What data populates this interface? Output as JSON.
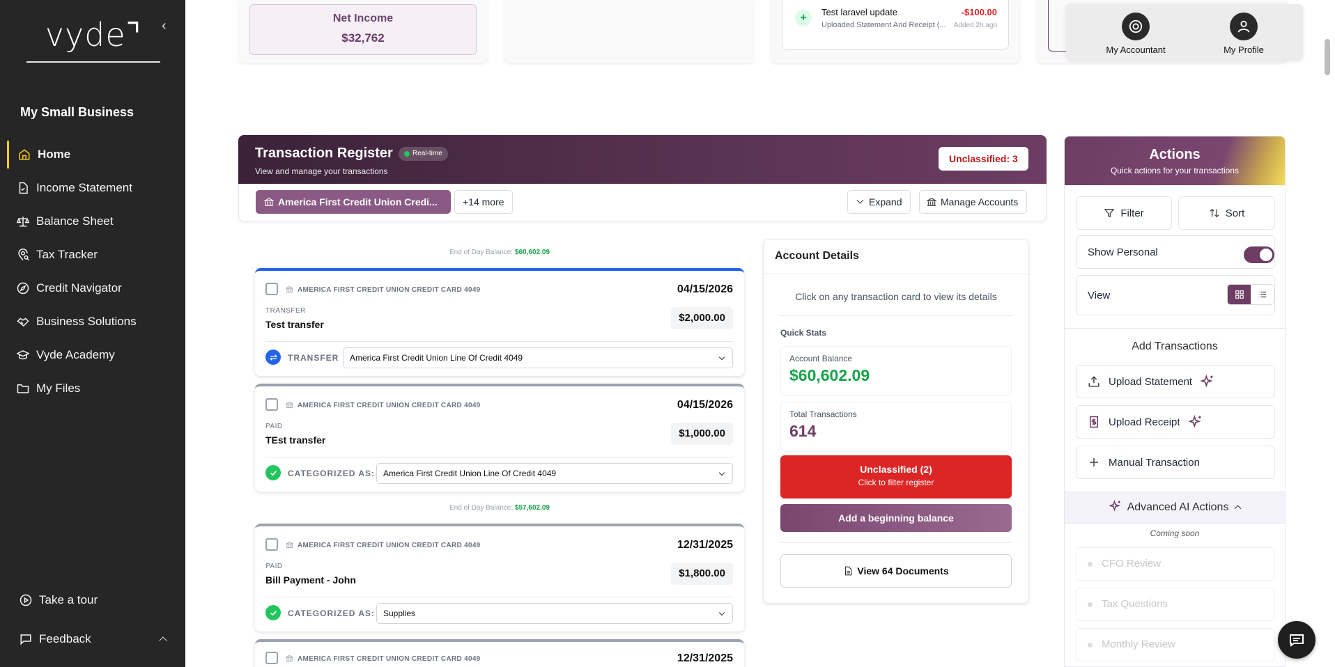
{
  "brand": {
    "logo": "vyde⌝",
    "business_name": "My Small Business"
  },
  "sidebar": {
    "items": [
      {
        "label": "Home",
        "icon": "home-icon",
        "active": true
      },
      {
        "label": "Income Statement",
        "icon": "document-icon"
      },
      {
        "label": "Balance Sheet",
        "icon": "scale-icon"
      },
      {
        "label": "Tax Tracker",
        "icon": "location-search-icon"
      },
      {
        "label": "Credit Navigator",
        "icon": "compass-icon"
      },
      {
        "label": "Business Solutions",
        "icon": "handshake-icon"
      },
      {
        "label": "Vyde Academy",
        "icon": "graduation-cap-icon"
      },
      {
        "label": "My Files",
        "icon": "folder-icon"
      }
    ],
    "tour_label": "Take a tour",
    "feedback_label": "Feedback"
  },
  "summary": {
    "net_income_label": "Net Income",
    "net_income_value": "$32,762"
  },
  "recent_activity": {
    "title": "Test laravel update",
    "subtitle": "Uploaded Statement And Receipt (...",
    "amount": "-$100.00",
    "time": "Added 2h ago"
  },
  "topnav": {
    "accountant_label": "My Accountant",
    "profile_label": "My Profile"
  },
  "register": {
    "title": "Transaction Register",
    "realtime_label": "Real-time",
    "subtitle": "View and manage your transactions",
    "unclassified_badge": "Unclassified: 3",
    "account_tab": "America First Credit Union Credi...",
    "more_tab": "+14 more",
    "expand_label": "Expand",
    "manage_label": "Manage Accounts"
  },
  "eod_label": "End of Day Balance:",
  "eod_balances": [
    "$60,602.09",
    "$57,602.09"
  ],
  "transactions": [
    {
      "account": "AMERICA FIRST CREDIT UNION CREDIT CARD 4049",
      "date": "04/15/2026",
      "type": "TRANSFER",
      "description": "Test transfer",
      "amount": "$2,000.00",
      "cat_label": "TRANSFER",
      "cat_value": "America First Credit Union Line Of Credit 4049",
      "accent": "#2563eb"
    },
    {
      "account": "AMERICA FIRST CREDIT UNION CREDIT CARD 4049",
      "date": "04/15/2026",
      "type": "PAID",
      "description": "TEst transfer",
      "amount": "$1,000.00",
      "cat_label": "CATEGORIZED AS:",
      "cat_value": "America First Credit Union Line Of Credit 4049",
      "accent": "#9ca3af"
    },
    {
      "account": "AMERICA FIRST CREDIT UNION CREDIT CARD 4049",
      "date": "12/31/2025",
      "type": "PAID",
      "description": "Bill Payment - John",
      "amount": "$1,800.00",
      "cat_label": "CATEGORIZED AS:",
      "cat_value": "Supplies",
      "accent": "#9ca3af"
    },
    {
      "account": "AMERICA FIRST CREDIT UNION CREDIT CARD 4049",
      "date": "12/31/2025"
    }
  ],
  "details": {
    "title": "Account Details",
    "hint": "Click on any transaction card to view its details",
    "quick_stats": "Quick Stats",
    "balance_label": "Account Balance",
    "balance_value": "$60,602.09",
    "txn_label": "Total Transactions",
    "txn_value": "614",
    "unclassified_title": "Unclassified (2)",
    "unclassified_sub": "Click to filter register",
    "beginning_balance": "Add a beginning balance",
    "documents": "View 64 Documents"
  },
  "actions": {
    "title": "Actions",
    "subtitle": "Quick actions for your transactions",
    "filter": "Filter",
    "sort": "Sort",
    "show_personal": "Show Personal",
    "view": "View",
    "add_title": "Add Transactions",
    "upload_statement": "Upload Statement",
    "upload_receipt": "Upload Receipt",
    "manual": "Manual Transaction",
    "advanced": "Advanced AI Actions",
    "coming_soon": "Coming soon",
    "ai_items": [
      "CFO Review",
      "Tax Questions",
      "Monthly Review"
    ]
  },
  "colors": {
    "brand": "#6d3d63",
    "accent": "#facc15",
    "positive": "#16a34a",
    "negative": "#dc2626"
  }
}
